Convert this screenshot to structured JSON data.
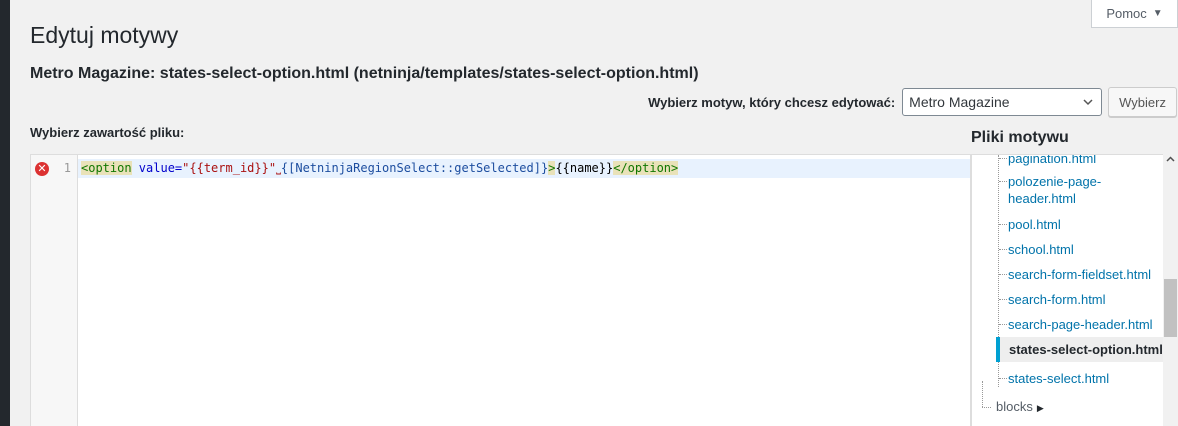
{
  "help": {
    "label": "Pomoc",
    "arrow": "▼"
  },
  "page": {
    "title": "Edytuj motywy",
    "file_heading": "Metro Magazine: states-select-option.html (netninja/templates/states-select-option.html)"
  },
  "theme_selector": {
    "label": "Wybierz motyw, który chcesz edytować:",
    "selected": "Metro Magazine",
    "button": "Wybierz"
  },
  "editor": {
    "label": "Wybierz zawartość pliku:",
    "line_number": "1",
    "lint_icon": "error-icon",
    "tokens": {
      "open_tag": "<option",
      "attr": " value=",
      "string": "\"{{term_id}}\"",
      "space_marker": "⎵",
      "plain": "{[NetninjaRegionSelect::getSelected]}",
      "close_bracket": ">",
      "text": "{{name}}",
      "close_tag": "</option>"
    }
  },
  "files_panel": {
    "title": "Pliki motywu",
    "items": [
      "pagination.html",
      "polozenie-page-header.html",
      "pool.html",
      "school.html",
      "search-form-fieldset.html",
      "search-form.html",
      "search-page-header.html",
      "states-select-option.html",
      "states-select.html"
    ],
    "polozenie_lines": [
      "polozenie-page-",
      "header.html"
    ],
    "folder": "blocks",
    "folder_caret": "▶"
  },
  "colors": {
    "accent": "#00a0d2",
    "link": "#0073aa",
    "error": "#dc3232"
  }
}
